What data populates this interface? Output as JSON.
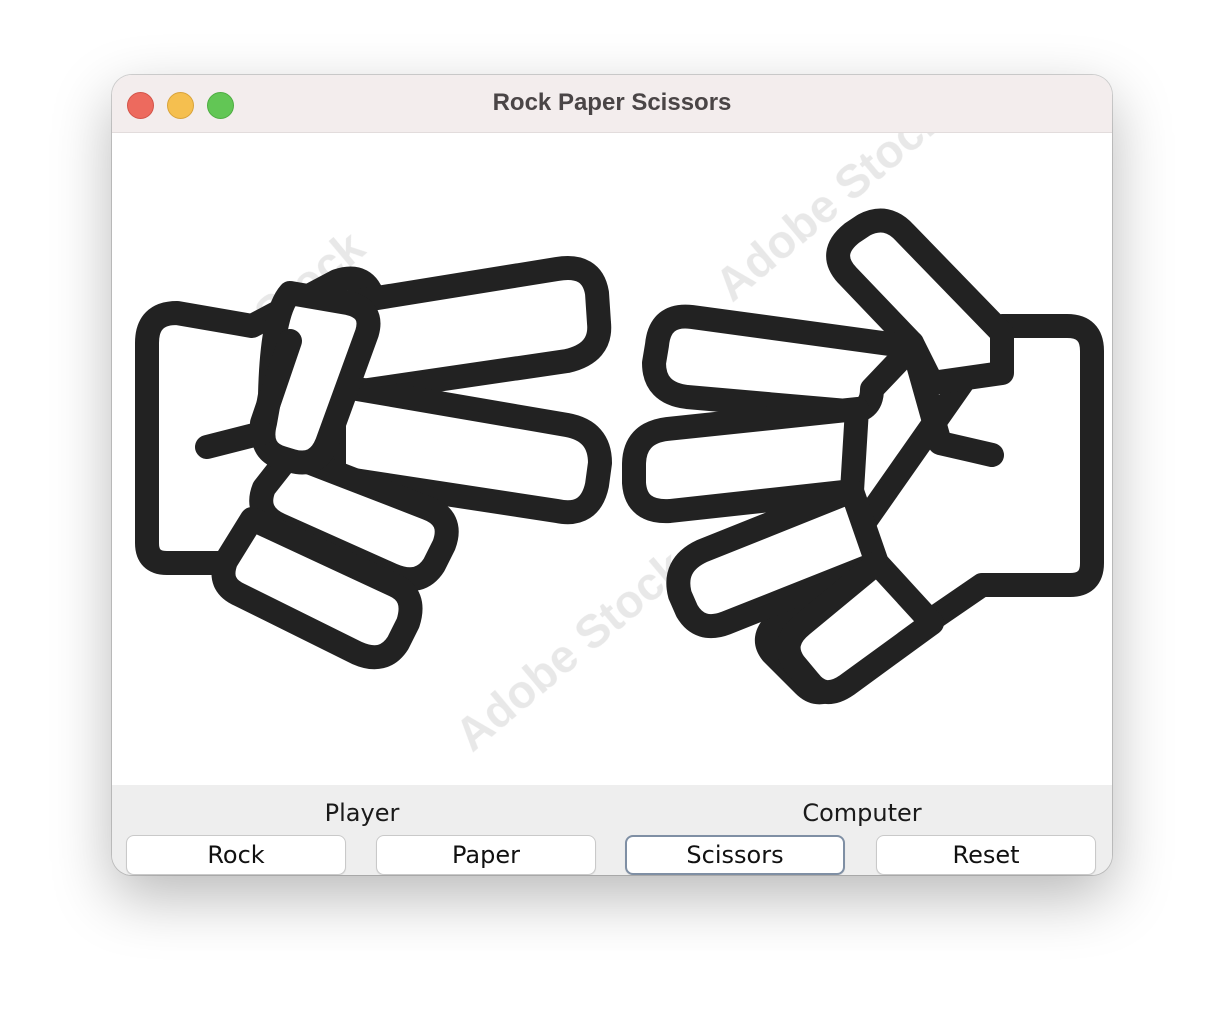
{
  "window": {
    "title": "Rock Paper Scissors"
  },
  "image": {
    "watermark_text": "Adobe Stock",
    "player_hand": "scissors-hand",
    "computer_hand": "paper-hand"
  },
  "labels": {
    "player": "Player",
    "computer": "Computer"
  },
  "buttons": {
    "rock": "Rock",
    "paper": "Paper",
    "scissors": "Scissors",
    "reset": "Reset"
  },
  "colors": {
    "titlebar_bg": "#f3eded",
    "controls_bg": "#eeeeee",
    "hand_stroke": "#222222",
    "close": "#ed6a5e",
    "minimize": "#f5bf4f",
    "maximize": "#62c655",
    "focus_ring": "#7f8fa4"
  }
}
